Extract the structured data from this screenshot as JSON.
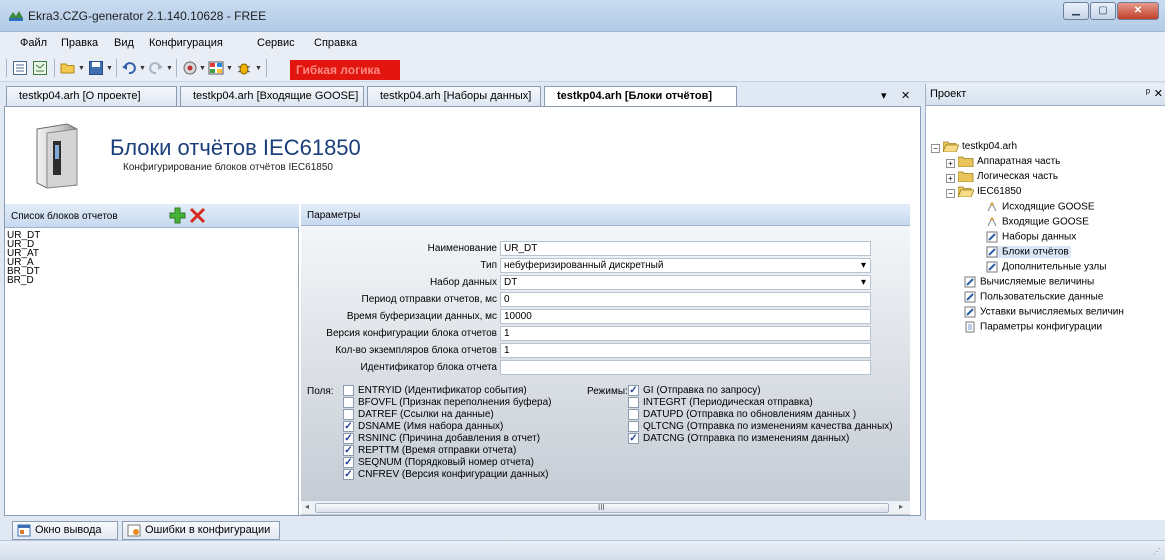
{
  "window": {
    "title": "Ekra3.CZG-generator 2.1.140.10628 - FREE"
  },
  "menu": [
    "Файл",
    "Правка",
    "Вид",
    "Конфигурация",
    "Сервис",
    "Справка"
  ],
  "toolbar": {
    "logic_button": "Гибкая логика"
  },
  "tabs": [
    {
      "label": "testkp04.arh [О проекте]"
    },
    {
      "label": "testkp04.arh [Входящие GOOSE]"
    },
    {
      "label": "testkp04.arh [Наборы данных]"
    },
    {
      "label": "testkp04.arh [Блоки отчётов]"
    }
  ],
  "header": {
    "title": "Блоки отчётов IEC61850",
    "subtitle": "Конфигурирование блоков отчётов IEC61850"
  },
  "report_list": {
    "header": "Список блоков отчетов",
    "items": [
      "UR_DT",
      "UR_D",
      "UR_AT",
      "UR_A",
      "BR_DT",
      "BR_D"
    ]
  },
  "params": {
    "header": "Параметры",
    "fields": [
      {
        "label": "Наименование",
        "value": "UR_DT"
      },
      {
        "label": "Тип",
        "value": "небуферизированный дискретный"
      },
      {
        "label": "Набор данных",
        "value": "DT"
      },
      {
        "label": "Период отправки отчетов, мс",
        "value": "0"
      },
      {
        "label": "Время буферизации данных, мс",
        "value": "10000"
      },
      {
        "label": "Версия конфигурации блока отчетов",
        "value": "1"
      },
      {
        "label": "Кол-во экземпляров блока отчетов",
        "value": "1"
      },
      {
        "label": "Идентификатор блока отчета",
        "value": ""
      }
    ],
    "fields_label": "Поля:",
    "field_options": [
      {
        "label": "ENTRYID (Идентификатор события)",
        "checked": false
      },
      {
        "label": "BFOVFL (Признак переполнения буфера)",
        "checked": false
      },
      {
        "label": "DATREF (Ссылки на данные)",
        "checked": false
      },
      {
        "label": "DSNAME (Имя набора данных)",
        "checked": true
      },
      {
        "label": "RSNINC (Причина добавления в отчет)",
        "checked": true
      },
      {
        "label": "REPTTM (Время отправки отчета)",
        "checked": true
      },
      {
        "label": "SEQNUM (Порядковый номер отчета)",
        "checked": true
      },
      {
        "label": "CNFREV (Версия конфигурации данных)",
        "checked": true
      }
    ],
    "modes_label": "Режимы:",
    "mode_options": [
      {
        "label": "GI (Отправка по запросу)",
        "checked": true
      },
      {
        "label": "INTEGRT (Периодическая отправка)",
        "checked": false
      },
      {
        "label": "DATUPD (Отправка по обновлениям данных )",
        "checked": false
      },
      {
        "label": "QLTCNG (Отправка по изменениям качества данных)",
        "checked": false
      },
      {
        "label": "DATCNG (Отправка по изменениям данных)",
        "checked": true
      }
    ]
  },
  "project": {
    "header": "Проект",
    "tree": [
      {
        "label": "testkp04.arh"
      },
      {
        "label": "Аппаратная часть"
      },
      {
        "label": "Логическая часть"
      },
      {
        "label": "IEC61850"
      },
      {
        "label": "Исходящие GOOSE"
      },
      {
        "label": "Входящие GOOSE"
      },
      {
        "label": "Наборы данных"
      },
      {
        "label": "Блоки отчётов"
      },
      {
        "label": "Дополнительные узлы"
      },
      {
        "label": "Вычисляемые величины"
      },
      {
        "label": "Пользовательские данные"
      },
      {
        "label": "Уставки вычисляемых величин"
      },
      {
        "label": "Параметры конфигурации"
      }
    ]
  },
  "bottom_tabs": [
    {
      "label": "Окно вывода"
    },
    {
      "label": "Ошибки в конфигурации"
    }
  ]
}
